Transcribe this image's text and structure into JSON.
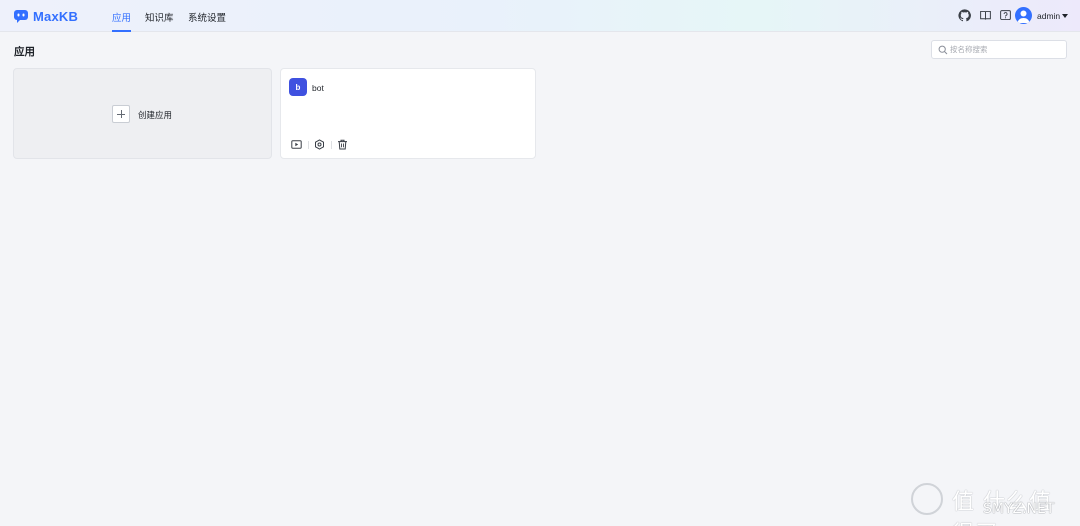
{
  "header": {
    "logo_text": "MaxKB",
    "nav": [
      {
        "label": "应用",
        "active": true
      },
      {
        "label": "知识库",
        "active": false
      },
      {
        "label": "系统设置",
        "active": false
      }
    ],
    "icons": [
      "github-icon",
      "book-icon",
      "help-icon"
    ],
    "user": {
      "name": "admin"
    }
  },
  "main": {
    "title": "应用",
    "search": {
      "placeholder": "按名称搜索",
      "value": ""
    },
    "create_card": {
      "label": "创建应用"
    },
    "apps": [
      {
        "avatar_letter": "b",
        "name": "bot",
        "avatar_color": "#3f51e0"
      }
    ],
    "app_actions": [
      "play-icon",
      "settings-icon",
      "delete-icon"
    ]
  },
  "watermark": {
    "line1": "值 什么值得买",
    "line2": "SMYZ.NET"
  },
  "colors": {
    "accent": "#3370ff",
    "background": "#f4f5f8"
  }
}
